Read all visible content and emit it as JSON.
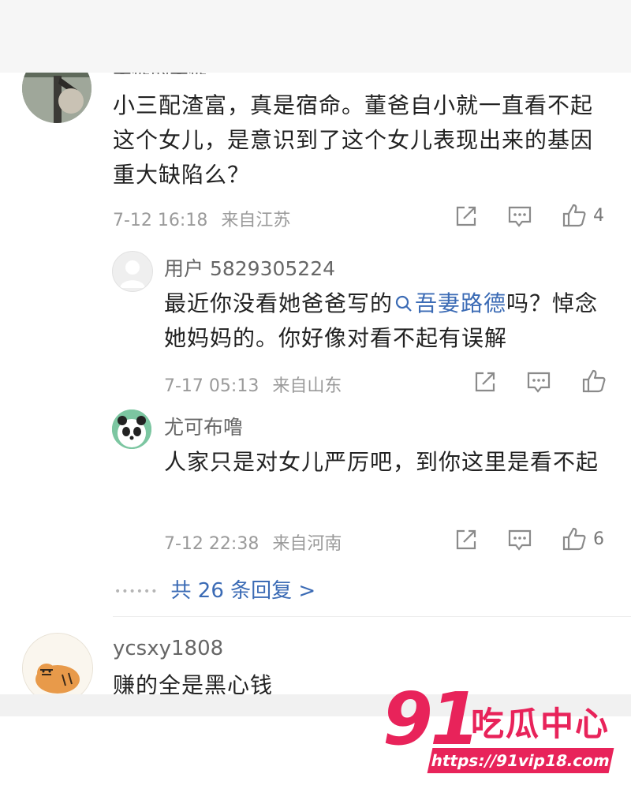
{
  "comments": [
    {
      "username_cut": "呆徒的呆徒",
      "text": "小三配渣富，真是宿命。董爸自小就一直看不起这个女儿，是意识到了这个女儿表现出来的基因重大缺陷么？",
      "time": "7-12 16:18",
      "location": "来自江苏",
      "likes": "4"
    }
  ],
  "replies": [
    {
      "username": "用户 5829305224",
      "text_before": "最近你没看她爸爸写的",
      "search_link": "吾妻路德",
      "text_after": "吗？悼念她妈妈的。你好像对看不起有误解",
      "time": "7-17 05:13",
      "location": "来自山东",
      "likes": ""
    },
    {
      "username": "尤可布噜",
      "text": "人家只是对女儿严厉吧，到你这里是看不起",
      "time": "7-12 22:38",
      "location": "来自河南",
      "likes": "6"
    }
  ],
  "more_replies": "共 26 条回复 >",
  "next_comment": {
    "username": "ycsxy1808",
    "text": "赚的全是黑心钱"
  },
  "watermark": {
    "number": "91",
    "name": "吃瓜中心",
    "url": "https://91vip18.com"
  },
  "icons": [
    "share-icon",
    "comment-icon",
    "like-icon"
  ],
  "colors": {
    "link": "#3b6bb5",
    "watermark": "#e8235a",
    "meta": "#9a9a9a"
  }
}
